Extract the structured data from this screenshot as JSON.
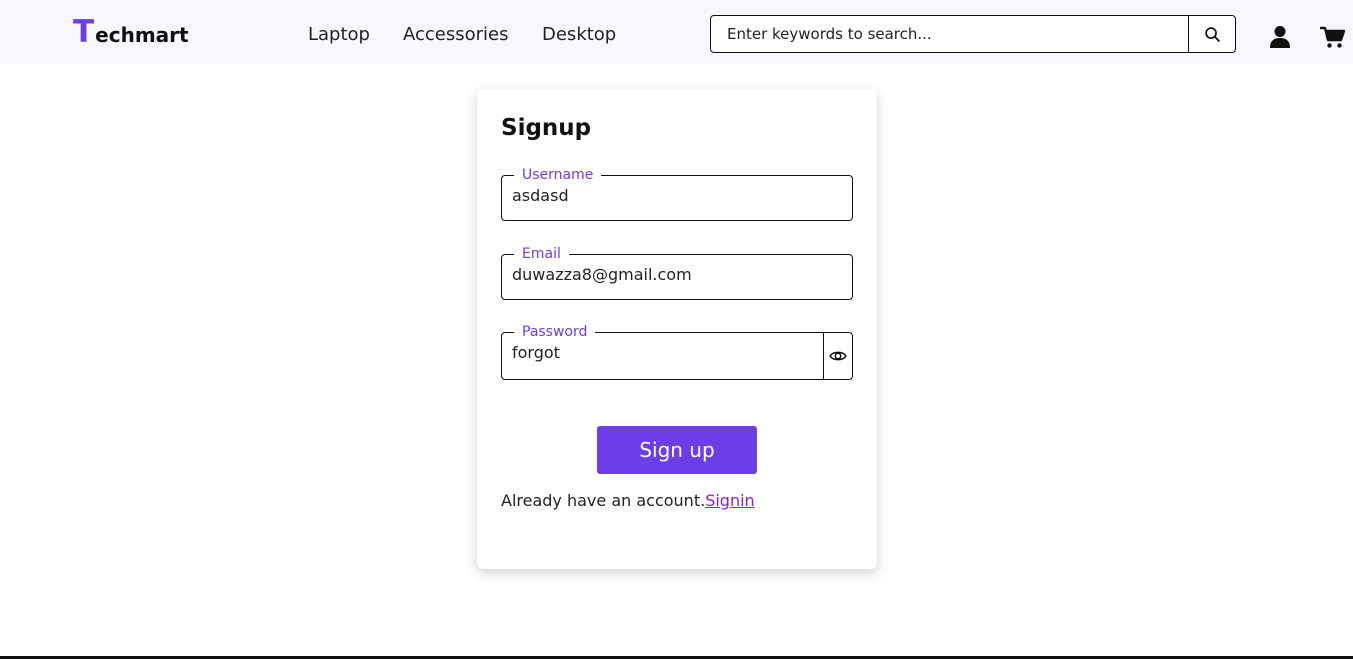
{
  "header": {
    "logo_first": "T",
    "logo_rest": "echmart",
    "nav": [
      "Laptop",
      "Accessories",
      "Desktop"
    ],
    "search_placeholder": "Enter keywords to search...",
    "icons": [
      "search-icon",
      "user-icon",
      "cart-icon"
    ]
  },
  "form": {
    "title": "Signup",
    "username_label": "Username",
    "username_value": "asdasd",
    "email_label": "Email",
    "email_value": "duwazza8@gmail.com",
    "password_label": "Password",
    "password_value": "forgot",
    "submit_label": "Sign up",
    "signin_text": "Already have an account.",
    "signin_link": "Signin"
  },
  "colors": {
    "accent": "#6b3ee8",
    "header_bg": "#f8f7fe",
    "link": "#8a1fcf"
  }
}
